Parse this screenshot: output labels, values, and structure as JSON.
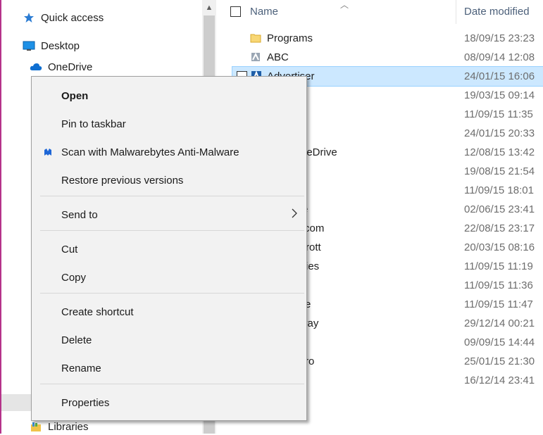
{
  "nav": {
    "items": [
      {
        "label": "Quick access",
        "icon": "star-icon"
      },
      {
        "label": "Desktop",
        "icon": "desktop-icon"
      },
      {
        "label": "OneDrive",
        "icon": "cloud-icon"
      },
      {
        "label": "Libraries",
        "icon": "library-icon"
      }
    ]
  },
  "files": {
    "header": {
      "name": "Name",
      "date": "Date modified"
    },
    "rows": [
      {
        "name": "Programs",
        "date": "18/09/15 23:23",
        "icon": "folder-icon"
      },
      {
        "name": "ABC",
        "date": "08/09/14 12:08",
        "icon": "app-icon"
      },
      {
        "name": "Advertiser",
        "date": "24/01/15 16:06",
        "icon": "app-icon",
        "selected": true
      },
      {
        "name": "",
        "date": "19/03/15 09:14"
      },
      {
        "name": "",
        "date": "11/09/15 11:35"
      },
      {
        "name": "",
        "date": "24/01/15 20:33"
      },
      {
        "name": "neDrive",
        "date": "12/08/15 13:42"
      },
      {
        "name": "",
        "date": "19/08/15 21:54"
      },
      {
        "name": "",
        "date": "11/09/15 18:01"
      },
      {
        "name": "e",
        "date": "02/06/15 23:41"
      },
      {
        "name": "com",
        "date": "22/08/15 23:17"
      },
      {
        "name": "rrott",
        "date": "20/03/15 08:16"
      },
      {
        "name": "ries",
        "date": "11/09/15 11:19"
      },
      {
        "name": "",
        "date": "11/09/15 11:36"
      },
      {
        "name": "e",
        "date": "11/09/15 11:47"
      },
      {
        "name": "vay",
        "date": "29/12/14 00:21"
      },
      {
        "name": "",
        "date": "09/09/15 14:44"
      },
      {
        "name": "ro",
        "date": "25/01/15 21:30"
      },
      {
        "name": "",
        "date": "16/12/14 23:41"
      }
    ]
  },
  "menu": {
    "open": "Open",
    "pin_taskbar": "Pin to taskbar",
    "scan": "Scan with Malwarebytes Anti-Malware",
    "restore": "Restore previous versions",
    "send_to": "Send to",
    "cut": "Cut",
    "copy": "Copy",
    "create_shortcut": "Create shortcut",
    "delete": "Delete",
    "rename": "Rename",
    "properties": "Properties"
  },
  "colors": {
    "selection": "#cce8ff",
    "menu_bg": "#f2f2f2",
    "header_text": "#4c607a",
    "accent_pink": "#b5338a"
  }
}
